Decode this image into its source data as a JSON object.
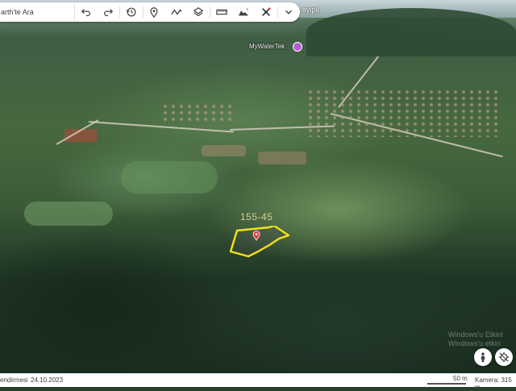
{
  "toolbar": {
    "search_text": "arth'te Ara",
    "buttons": [
      {
        "name": "undo-button",
        "icon": "undo-icon"
      },
      {
        "name": "redo-button",
        "icon": "redo-icon"
      },
      {
        "name": "history-button",
        "icon": "history-icon"
      },
      {
        "name": "add-placemark-button",
        "icon": "pin-icon"
      },
      {
        "name": "draw-line-button",
        "icon": "path-icon"
      },
      {
        "name": "layers-button",
        "icon": "layers-icon"
      },
      {
        "name": "measure-button",
        "icon": "ruler-icon"
      },
      {
        "name": "map-style-button",
        "icon": "map-style-icon"
      },
      {
        "name": "satellite-button",
        "icon": "satellite-icon"
      },
      {
        "name": "more-button",
        "icon": "chevron-down-icon"
      }
    ]
  },
  "map": {
    "top_label": "ayipli",
    "place_name": "MyWaterTek",
    "parcel_label": "155-45",
    "watermark_line1": "Windows'u Etkinl",
    "watermark_line2": "Windows'u etkin",
    "accent_color": "#f5e11a",
    "pin_color": "#e53935",
    "place_pin_color": "#b660cf"
  },
  "controls": {
    "street_view": "pegman-icon",
    "location": "location-off-icon"
  },
  "status": {
    "left_text": "endirmesi",
    "date": "24.10.2023",
    "scale": "50 m",
    "camera": "Kamera: 315 m"
  }
}
